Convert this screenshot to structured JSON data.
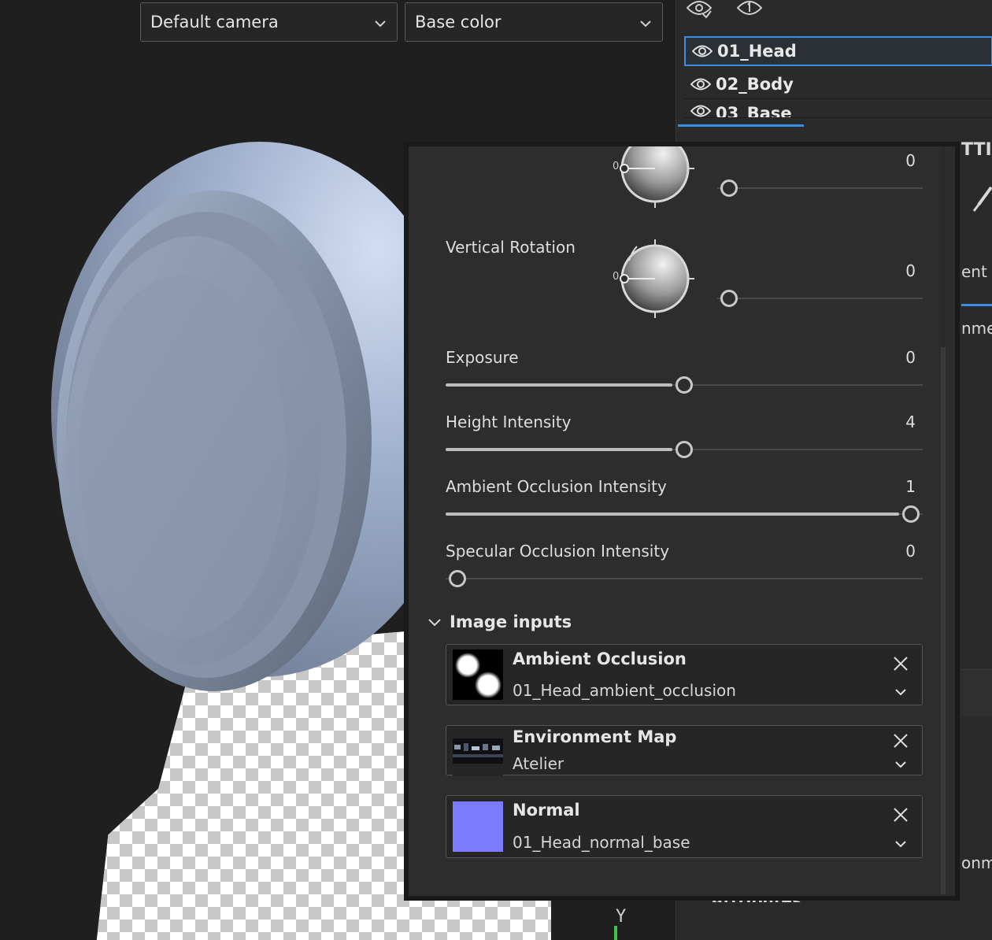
{
  "viewport": {
    "camera_dropdown": "Default camera",
    "channel_dropdown": "Base color",
    "axis_label": "Y"
  },
  "layers": {
    "items": [
      {
        "name": "01_Head",
        "selected": true
      },
      {
        "name": "02_Body",
        "selected": false
      },
      {
        "name": "03_Base",
        "selected": false
      }
    ]
  },
  "right_panel_fragments": {
    "tab_title_fragment": "TTI",
    "item_fragment_1": "ent",
    "item_fragment_2": "nme",
    "item_fragment_3": "onme",
    "bottom_header_fragment": "Attributes"
  },
  "properties": {
    "horizontal_rotation": {
      "value": "0",
      "dial_zero": "0",
      "slider_fraction": 0.0
    },
    "vertical_rotation": {
      "label": "Vertical Rotation",
      "value": "0",
      "dial_zero": "0",
      "slider_fraction": 0.0
    },
    "exposure": {
      "label": "Exposure",
      "value": "0",
      "slider_fraction": 0.5
    },
    "height_intensity": {
      "label": "Height Intensity",
      "value": "4",
      "slider_fraction": 0.5
    },
    "ao_intensity": {
      "label": "Ambient Occlusion Intensity",
      "value": "1",
      "slider_fraction": 1.0
    },
    "so_intensity": {
      "label": "Specular Occlusion Intensity",
      "value": "0",
      "slider_fraction": 0.0
    }
  },
  "image_inputs": {
    "header": "Image inputs",
    "items": [
      {
        "title": "Ambient Occlusion",
        "value": "01_Head_ambient_occlusion",
        "thumb_icon": "ao-map-thumbnail"
      },
      {
        "title": "Environment Map",
        "value": "Atelier",
        "thumb_icon": "environment-map-thumbnail"
      },
      {
        "title": "Normal",
        "value": "01_Head_normal_base",
        "thumb_color": "#7b7bff"
      }
    ]
  },
  "colors": {
    "accent": "#3a8ee6",
    "normal_map": "#7b7bff",
    "axis_y": "#3fc34a"
  }
}
